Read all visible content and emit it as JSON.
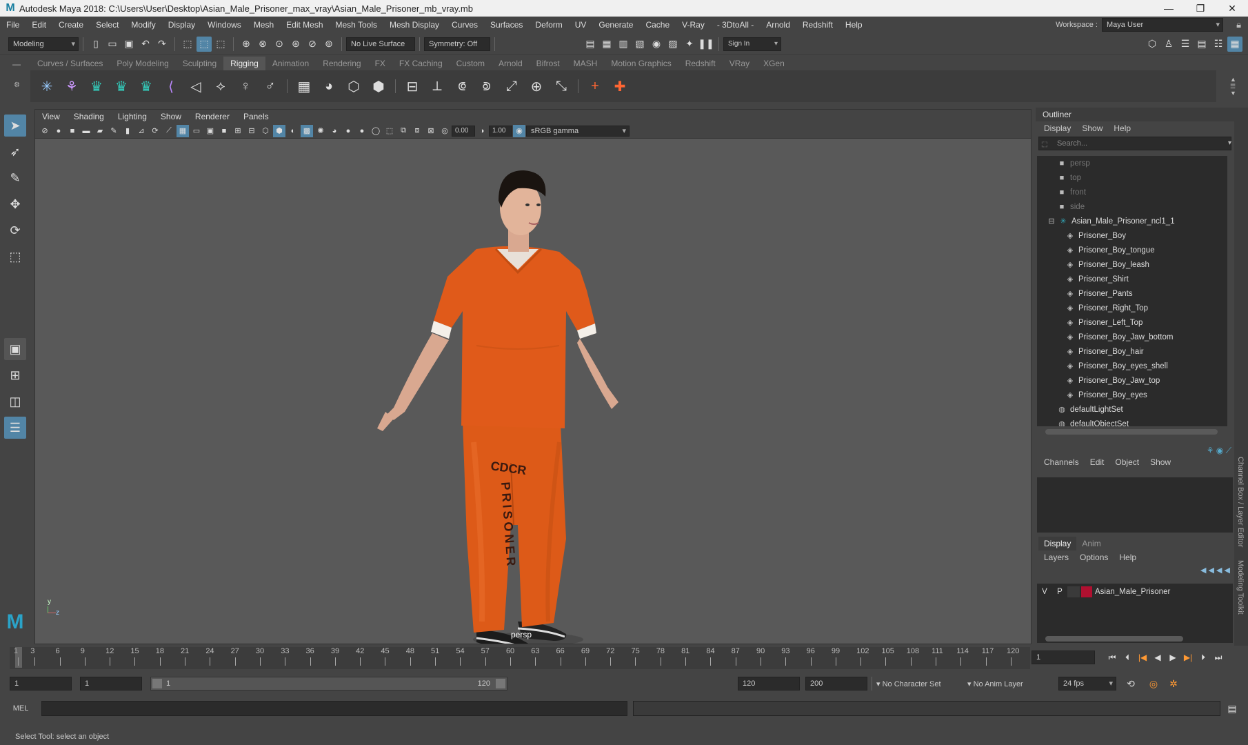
{
  "window": {
    "title": "Autodesk Maya 2018: C:\\Users\\User\\Desktop\\Asian_Male_Prisoner_max_vray\\Asian_Male_Prisoner_mb_vray.mb",
    "minimize": "—",
    "maximize": "❐",
    "close": "✕"
  },
  "menubar": {
    "items": [
      "File",
      "Edit",
      "Create",
      "Select",
      "Modify",
      "Display",
      "Windows",
      "Mesh",
      "Edit Mesh",
      "Mesh Tools",
      "Mesh Display",
      "Curves",
      "Surfaces",
      "Deform",
      "UV",
      "Generate",
      "Cache",
      "V-Ray",
      "- 3DtoAll -",
      "Arnold",
      "Redshift",
      "Help"
    ],
    "workspace_label": "Workspace :",
    "workspace_value": "Maya User"
  },
  "statusline": {
    "mode": "Modeling",
    "live_surface": "No Live Surface",
    "symmetry": "Symmetry: Off",
    "sign_in": "Sign In"
  },
  "shelf": {
    "tabs": [
      "Curves / Surfaces",
      "Poly Modeling",
      "Sculpting",
      "Rigging",
      "Animation",
      "Rendering",
      "FX",
      "FX Caching",
      "Custom",
      "Arnold",
      "Bifrost",
      "MASH",
      "Motion Graphics",
      "Redshift",
      "VRay",
      "XGen"
    ],
    "active_tab": "Rigging"
  },
  "viewport": {
    "menu": [
      "View",
      "Shading",
      "Lighting",
      "Show",
      "Renderer",
      "Panels"
    ],
    "exposure": "0.00",
    "gamma": "1.00",
    "color_space": "sRGB gamma",
    "camera_label": "persp",
    "pants_text_1": "CDCR",
    "pants_text_2": "PRISONER",
    "axis_y": "y",
    "axis_z": "z"
  },
  "outliner": {
    "title": "Outliner",
    "menu": [
      "Display",
      "Show",
      "Help"
    ],
    "search_placeholder": "Search...",
    "cameras": [
      "persp",
      "top",
      "front",
      "side"
    ],
    "group": "Asian_Male_Prisoner_ncl1_1",
    "children": [
      "Prisoner_Boy",
      "Prisoner_Boy_tongue",
      "Prisoner_Boy_leash",
      "Prisoner_Shirt",
      "Prisoner_Pants",
      "Prisoner_Right_Top",
      "Prisoner_Left_Top",
      "Prisoner_Boy_Jaw_bottom",
      "Prisoner_Boy_hair",
      "Prisoner_Boy_eyes_shell",
      "Prisoner_Boy_Jaw_top",
      "Prisoner_Boy_eyes"
    ],
    "sets": [
      "defaultLightSet",
      "defaultObjectSet"
    ]
  },
  "channelbox": {
    "menu": [
      "Channels",
      "Edit",
      "Object",
      "Show"
    ],
    "layer_tabs": [
      "Display",
      "Anim"
    ],
    "layer_menu": [
      "Layers",
      "Options",
      "Help"
    ],
    "layer": {
      "v": "V",
      "p": "P",
      "name": "Asian_Male_Prisoner",
      "color": "#b01030"
    }
  },
  "sidetabs": {
    "channel": "Channel Box / Layer Editor",
    "modeling": "Modeling Toolkit"
  },
  "timeline": {
    "ticks": [
      "1",
      "3",
      "6",
      "9",
      "12",
      "15",
      "18",
      "21",
      "24",
      "27",
      "30",
      "33",
      "36",
      "39",
      "42",
      "45",
      "48",
      "51",
      "54",
      "57",
      "60",
      "63",
      "66",
      "69",
      "72",
      "75",
      "78",
      "81",
      "84",
      "87",
      "90",
      "93",
      "96",
      "99",
      "102",
      "105",
      "108",
      "111",
      "114",
      "117",
      "120"
    ],
    "current_frame": "1"
  },
  "range": {
    "start": "1",
    "playback_start": "1",
    "range_start": "1",
    "range_end": "120",
    "playback_end": "120",
    "end": "200",
    "character_set": "No Character Set",
    "anim_layer": "No Anim Layer",
    "fps": "24 fps"
  },
  "cmdline": {
    "label": "MEL"
  },
  "helpline": {
    "text": "Select Tool: select an object"
  },
  "colors": {
    "accent": "#5285a6",
    "orange_suit": "#e05a1a"
  }
}
